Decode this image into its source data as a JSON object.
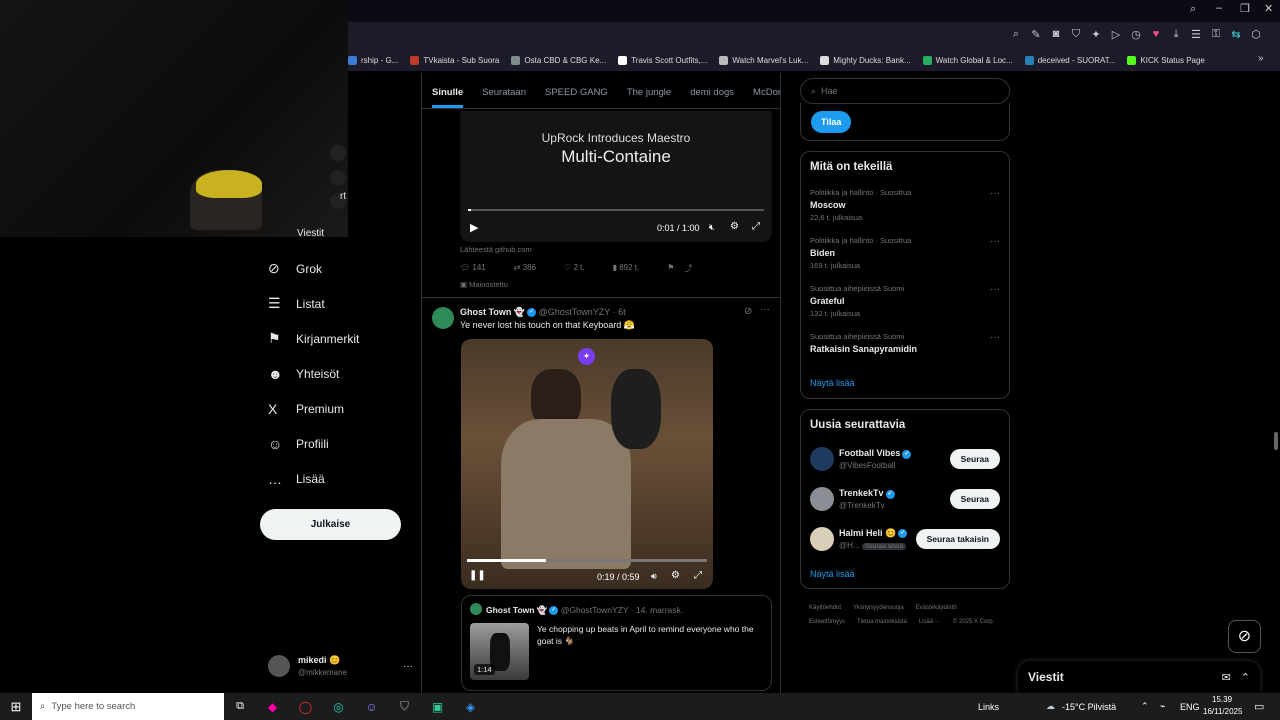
{
  "bookmarks": [
    {
      "label": "rship - G...",
      "color": "#3a7bd5"
    },
    {
      "label": "TVkaista - Sub Suora",
      "color": "#c0392b"
    },
    {
      "label": "Osta CBD & CBG Ke...",
      "color": "#7f8c8d"
    },
    {
      "label": "Travis Scott Outfits,...",
      "color": "#ffffff"
    },
    {
      "label": "Watch Marvel's Luk...",
      "color": "#bbbbbb"
    },
    {
      "label": "Mighty Ducks: Bank...",
      "color": "#dddddd"
    },
    {
      "label": "Watch Global & Loc...",
      "color": "#27ae60"
    },
    {
      "label": "deceived - SUORAT...",
      "color": "#2980b9"
    },
    {
      "label": "KICK Status Page",
      "color": "#53fc18"
    }
  ],
  "sidebar": {
    "items": [
      {
        "label": "Grok",
        "icon": "grok-icon",
        "glyph": "⊘"
      },
      {
        "label": "Listat",
        "icon": "list-icon",
        "glyph": "☰"
      },
      {
        "label": "Kirjanmerkit",
        "icon": "bookmark-icon",
        "glyph": "⚑"
      },
      {
        "label": "Yhteisöt",
        "icon": "communities-icon",
        "glyph": "☻"
      },
      {
        "label": "Premium",
        "icon": "x-logo-icon",
        "glyph": "X"
      },
      {
        "label": "Profiili",
        "icon": "profile-icon",
        "glyph": "☺"
      },
      {
        "label": "Lisää",
        "icon": "more-circle-icon",
        "glyph": "…"
      }
    ],
    "post_label": "Julkaise",
    "account_name": "mikedi",
    "account_handle": "@mikkemane",
    "partial_item": "Viestit",
    "cut_text": "rt"
  },
  "feed": {
    "tabs": [
      "Sinulle",
      "Seurataan",
      "SPEED GANG",
      "The jungle",
      "demi dogs",
      "McDonal"
    ],
    "ad": {
      "title": "UpRock Introduces Maestro",
      "subtitle": "Multi-Containe",
      "time": "0:01 / 1:00",
      "source": "Lähteestä github.com",
      "replies": "141",
      "reposts": "386",
      "likes": "2 t.",
      "views": "892 t.",
      "sponsored": "Mainostettu"
    },
    "tweet": {
      "name": "Ghost Town",
      "handle": "@GhostTownYZY",
      "time": "· 6t",
      "text": "Ye never lost his touch on that Keyboard 😤",
      "video_time": "0:19 / 0:59",
      "progress": 0.33,
      "quote": {
        "name": "Ghost Town",
        "handle": "@GhostTownYZY · 14. marrask.",
        "text": "Ye chopping up beats in April to remind everyone who the goat is 🐐",
        "duration": "1:14"
      }
    }
  },
  "right": {
    "search_placeholder": "Hae",
    "subscribe_label": "Tilaa",
    "trends_title": "Mitä on tekeillä",
    "trends": [
      {
        "cat": "Politiikka ja hallinto · Suosittua",
        "name": "Moscow",
        "count": "22,6 t. julkaisua"
      },
      {
        "cat": "Politiikka ja hallinto · Suosittua",
        "name": "Biden",
        "count": "169 t. julkaisua"
      },
      {
        "cat": "Suosittua aihepiirissä Suomi",
        "name": "Grateful",
        "count": "132 t. julkaisua"
      },
      {
        "cat": "Suosittua aihepiirissä Suomi",
        "name": "Ratkaisin Sanapyramidin",
        "count": ""
      }
    ],
    "show_more": "Näytä lisää",
    "follow_title": "Uusia seurattavia",
    "follows": [
      {
        "name": "Football Vibes",
        "handle": "@VibesFootball",
        "button": "Seuraa",
        "avatar_color": "#1e3a5f"
      },
      {
        "name": "TrenkekTv",
        "handle": "@TrenkekTv",
        "button": "Seuraa",
        "avatar_color": "#8a8f95"
      },
      {
        "name": "Halmi Heli 😊",
        "handle": "@H...",
        "button": "Seuraa takaisin",
        "avatar_color": "#d8cfb8",
        "badge": "Seuraa sinua"
      }
    ],
    "show_more2": "Näytä lisää",
    "footer": [
      "Käyttöehdot",
      "Yksityisyydensuoja",
      "Evästekäytäntö",
      "Esteettömyys",
      "Tietoa mainoksista",
      "Lisää ···",
      "© 2025 X Corp."
    ],
    "messages": "Viestit"
  },
  "taskbar": {
    "search_placeholder": "Type here to search",
    "links": "Links",
    "weather": "-15°C Pilvistä",
    "lang": "ENG",
    "time": "15.39",
    "date": "16/11/2025"
  }
}
